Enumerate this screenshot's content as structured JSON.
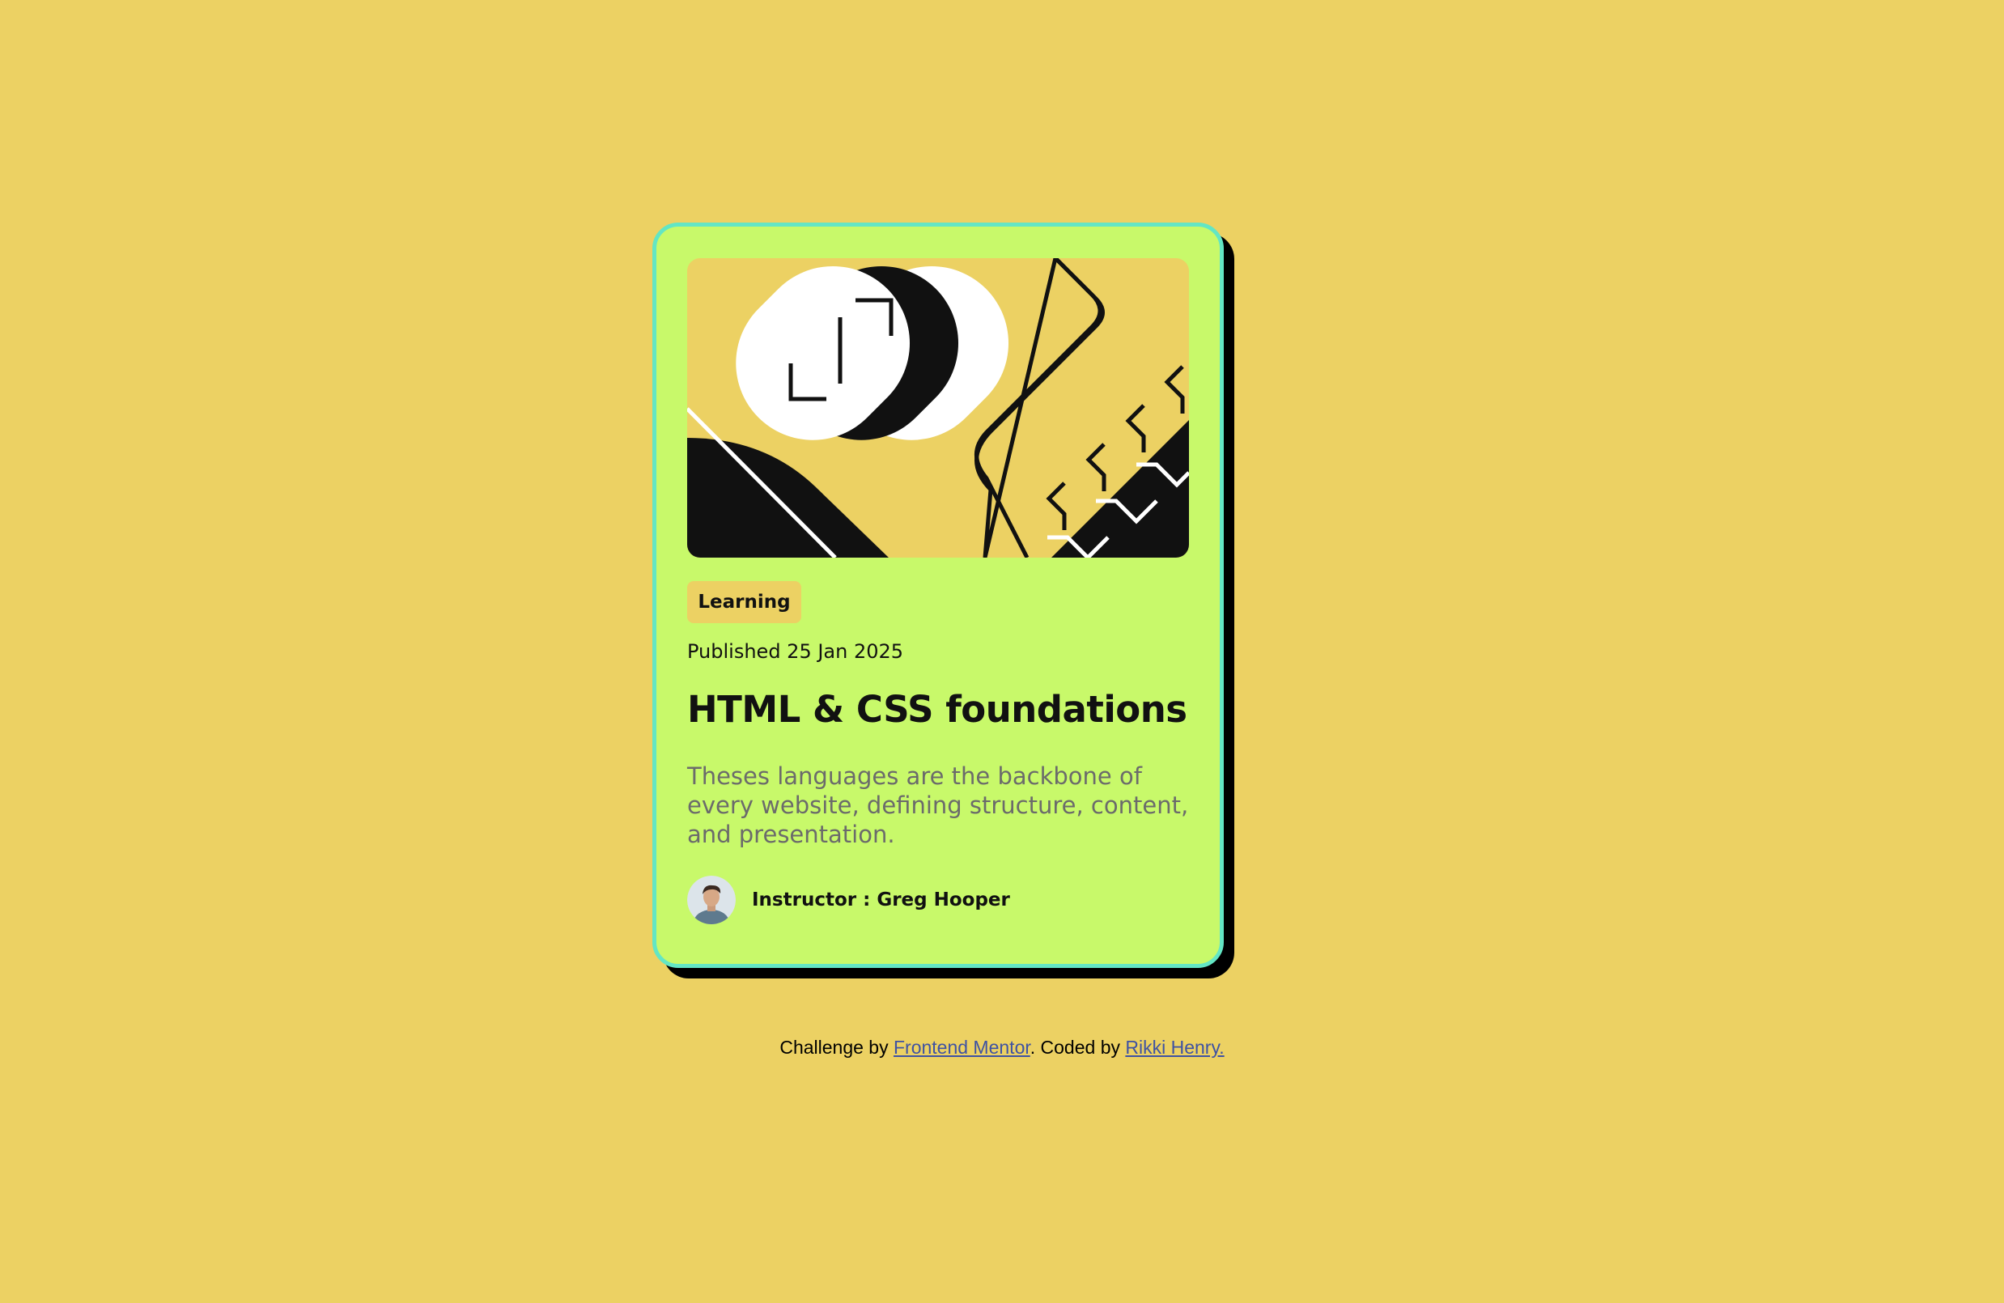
{
  "card": {
    "hero_image": "illustration-article",
    "tag": "Learning",
    "published": "Published 25 Jan 2025",
    "title": "HTML & CSS foundations",
    "description": "Theses languages are the backbone of every website, defining structure, content, and presentation.",
    "author": {
      "avatar": "avatar-photo",
      "name": "Instructor : Greg Hooper"
    }
  },
  "attribution": {
    "prefix": "Challenge by ",
    "link1": "Frontend Mentor",
    "middle": ". Coded by ",
    "link2": "Rikki Henry."
  },
  "colors": {
    "background": "#ECD163",
    "card": "#C8F96A",
    "card_border": "#63E6C4",
    "shadow": "#000000",
    "text": "#111111",
    "muted_text": "#6B6B6B",
    "link": "#3E52A3"
  }
}
